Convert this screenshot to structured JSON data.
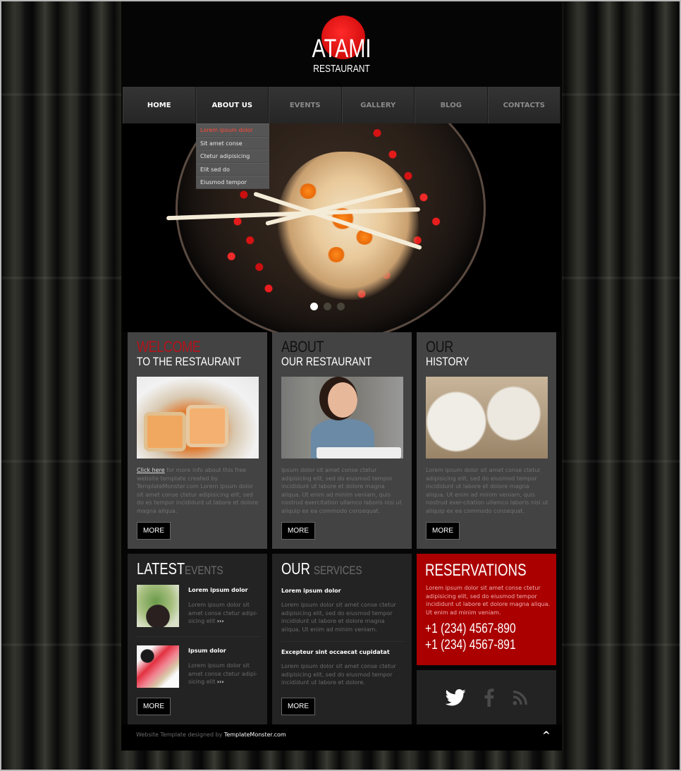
{
  "logo": {
    "title": "ATAMI",
    "subtitle": "RESTAURANT",
    "accent_color": "#e01010"
  },
  "nav": {
    "items": [
      {
        "label": "HOME",
        "state": "active"
      },
      {
        "label": "ABOUT US",
        "state": "open"
      },
      {
        "label": "EVENTS",
        "state": "normal"
      },
      {
        "label": "GALLERY",
        "state": "normal"
      },
      {
        "label": "BLOG",
        "state": "normal"
      },
      {
        "label": "CONTACTS",
        "state": "normal"
      }
    ],
    "dropdown": [
      {
        "label": "Lorem ipsum dolor",
        "hover": true
      },
      {
        "label": "Sit amet conse"
      },
      {
        "label": "Ctetur adipisicing"
      },
      {
        "label": "Elit sed do"
      },
      {
        "label": "Eiusmod tempor"
      }
    ]
  },
  "slider": {
    "slide_count": 3,
    "active_slide": 1
  },
  "boxes": [
    {
      "title_line1": "WELCOME",
      "title_line2": "TO THE RESTAURANT",
      "link_text": "Click here",
      "text": " for more info about this free website template created by TemplateMonster.com Lorem ipsum dolor sit amet conse ctetur adipisicing elit, sed do es tempor incididunt ut labore et dolore magna aliqua.",
      "button": "MORE"
    },
    {
      "title_line1": "ABOUT",
      "title_line2": "OUR RESTAURANT",
      "text": "Ipsum dolor sit amet conse ctetur adipisicing elit, sed do eiusmod tempor incididunt ut labore et dolore magna aliqua. Ut enim ad minim veniam, quis nostrud exercitation ullamco laboris nisi ut aliquip ex ea commodo consequat.",
      "button": "MORE"
    },
    {
      "title_line1": "OUR",
      "title_line2": "HISTORY",
      "text": "Lorem ipsum dolor sit amet conse ctetur adipisicing elit, sed do eiusmod tempor incididunt ut labore et dolore magna aliqua. Ut enim ad minim veniam, quis nostrud exer-citation ullamco laboris nisi ut aliquip ex ea commodo consequat.",
      "button": "MORE"
    }
  ],
  "events": {
    "title_strong": "LATEST",
    "title_light": "EVENTS",
    "items": [
      {
        "title": "Lorem ipsum dolor",
        "text": "Lorem ipsum dolor sit amet conse ctetur adipi-sicing elit ",
        "more": "›››"
      },
      {
        "title": "Ipsum dolor",
        "text": "Lorem ipsum dolor sit amet conse ctetur adipi-sicing elit ",
        "more": "›››"
      }
    ],
    "button": "MORE"
  },
  "services": {
    "title_strong": "OUR",
    "title_light": "SERVICES",
    "items": [
      {
        "title": "Lorem ipsum dolor",
        "text": "Lorem ipsum dolor sit amet conse ctetur adipisicing elit, sed do eiusmod tempor incididunt ut labore et dolore magna aliqua. Ut enim ad minim veniam."
      },
      {
        "title": "Excepteur sint occaecat cupidatat",
        "text": "Lorem ipsum dolor sit amet conse ctetur adipisicing elit, sed do eiusmod tempor incididunt ut labore et dolore."
      }
    ],
    "button": "MORE"
  },
  "reservations": {
    "title": "RESERVATIONS",
    "text": "Lorem ipsum dolor sit amet conse ctetur adipisicing elit, sed do eiusmod tempor incididunt ut labore et dolore magna aliqua. Ut enim ad minim veniam.",
    "phones": [
      "+1 (234) 4567-890",
      "+1 (234) 4567-891"
    ],
    "bg_color": "#aa0000"
  },
  "social": {
    "icons": [
      "twitter-icon",
      "facebook-icon",
      "rss-icon"
    ]
  },
  "footer": {
    "text": "Website Template designed by ",
    "link": "TemplateMonster.com",
    "to_top": "^"
  }
}
